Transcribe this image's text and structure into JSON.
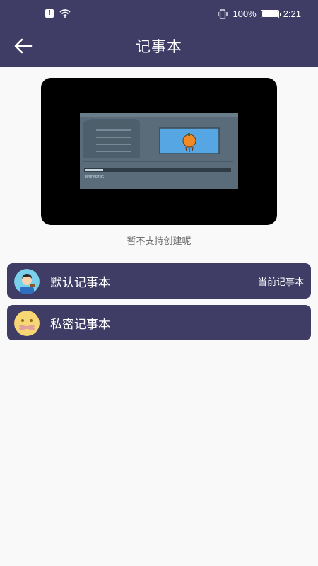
{
  "status_bar": {
    "notification_icon": "alert-icon",
    "wifi_icon": "wifi-icon",
    "vibrate_icon": "vibrate-icon",
    "battery_percent": "100%",
    "time": "2:21"
  },
  "header": {
    "back_icon": "arrow-left-icon",
    "title": "记事本",
    "background": "#3f3d66"
  },
  "preview": {
    "caption": "RENDERING",
    "empty_message": "暂不支持创建呢"
  },
  "notebooks": [
    {
      "name": "默认记事本",
      "tag": "当前记事本",
      "avatar": "user-avatar-icon"
    },
    {
      "name": "私密记事本",
      "tag": "",
      "avatar": "secret-emoji-icon"
    }
  ]
}
